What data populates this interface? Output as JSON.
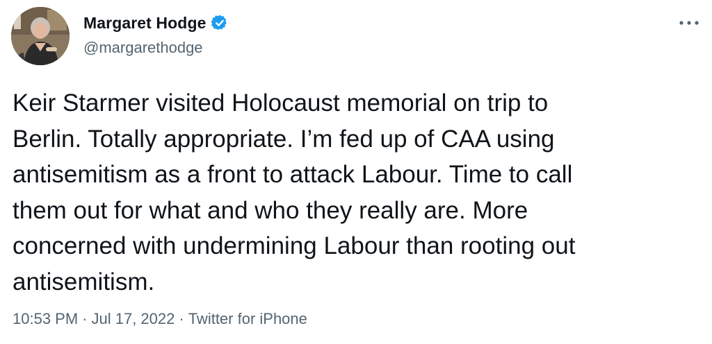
{
  "author": {
    "display_name": "Margaret Hodge",
    "handle": "@margarethodge",
    "verified": true,
    "verified_color": "#1d9bf0",
    "avatar_icon": "profile-photo"
  },
  "tweet": {
    "text": "Keir Starmer visited Holocaust memorial on trip to\nBerlin. Totally appropriate. I’m fed up of CAA using\nantisemitism as a front to attack Labour. Time to call\nthem out for what and who they really are. More\nconcerned with undermining Labour than rooting out\nantisemitism."
  },
  "meta": {
    "time": "10:53 PM",
    "separator": "·",
    "date": "Jul 17, 2022",
    "source": "Twitter for iPhone"
  },
  "menu": {
    "icon": "more-horizontal-icon"
  },
  "colors": {
    "text_primary": "#0f1419",
    "text_secondary": "#536471",
    "background": "#ffffff"
  }
}
